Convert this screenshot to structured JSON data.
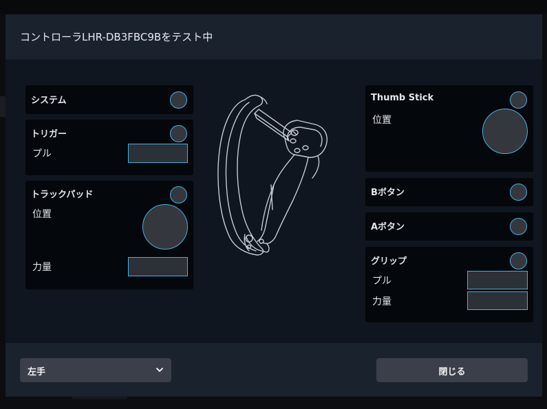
{
  "dialog": {
    "title": "コントローラLHR-DB3FBC9Bをテスト中"
  },
  "left_panels": {
    "system": {
      "label": "システム"
    },
    "trigger": {
      "label": "トリガー",
      "pull_label": "プル",
      "pull_value": 0
    },
    "trackpad": {
      "label": "トラックパッド",
      "position_label": "位置",
      "force_label": "力量",
      "force_value": 0
    }
  },
  "right_panels": {
    "thumbstick": {
      "label": "Thumb Stick",
      "position_label": "位置"
    },
    "b_button": {
      "label": "Bボタン"
    },
    "a_button": {
      "label": "Aボタン"
    },
    "grip": {
      "label": "グリップ",
      "pull_label": "プル",
      "pull_value": 0,
      "force_label": "力量",
      "force_value": 0
    }
  },
  "footer": {
    "hand_select_value": "左手",
    "close_label": "閉じる"
  },
  "icons": {
    "controller": "controller-outline-icon",
    "dropdown": "chevron-down-icon"
  },
  "colors": {
    "accent": "#45b2e0",
    "indicator_fill": "#34383e",
    "panel_bg": "#04070b",
    "dialog_bg": "#0f1620",
    "header_bg": "#1a222e",
    "button_bg": "#3a3f4a"
  }
}
